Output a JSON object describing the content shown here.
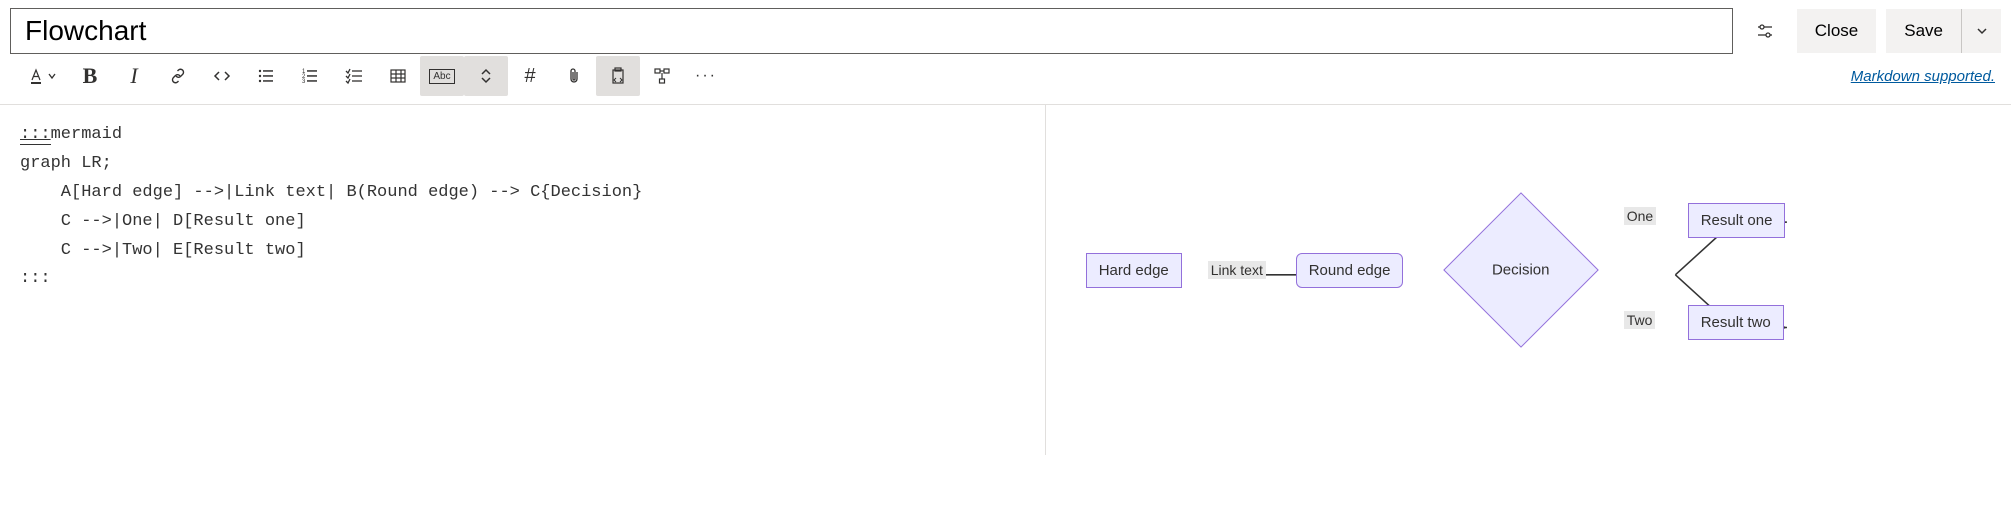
{
  "header": {
    "title": "Flowchart",
    "close_label": "Close",
    "save_label": "Save"
  },
  "toolbar": {
    "markdown_link": "Markdown supported.",
    "abc_label": "Abc"
  },
  "editor": {
    "line1_open": ":::",
    "line1_mermaid": "mermaid",
    "line2": "graph LR;",
    "line3": "    A[Hard edge] -->|Link text| B(Round edge) --> C{Decision}",
    "line4": "    C -->|One| D[Result one]",
    "line5": "    C -->|Two| E[Result two]",
    "line6": ":::"
  },
  "diagram": {
    "nodeA": "Hard edge",
    "nodeB": "Round edge",
    "nodeC": "Decision",
    "nodeD": "Result one",
    "nodeE": "Result two",
    "edgeAB": "Link text",
    "edgeCD": "One",
    "edgeCE": "Two"
  }
}
